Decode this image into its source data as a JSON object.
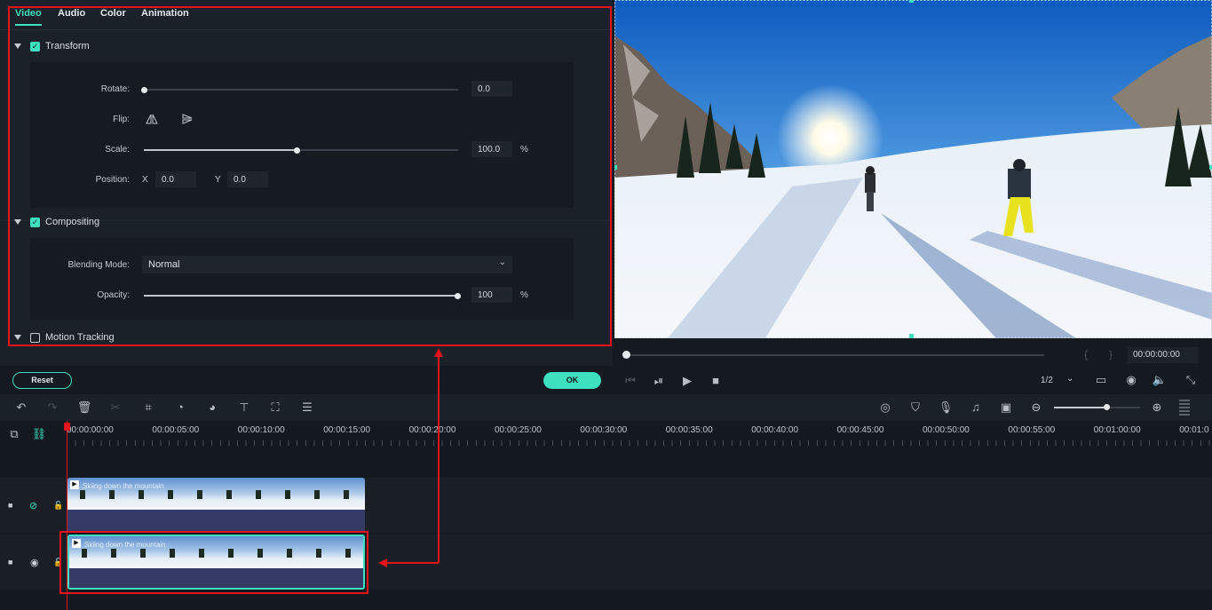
{
  "tabs": [
    "Video",
    "Audio",
    "Color",
    "Animation"
  ],
  "transform": {
    "title": "Transform",
    "rotate_label": "Rotate:",
    "rotate_value": "0.0",
    "flip_label": "Flip:",
    "scale_label": "Scale:",
    "scale_value": "100.0",
    "scale_unit": "%",
    "scale_level": 0.49,
    "position_label": "Position:",
    "pos_x_label": "X",
    "pos_x_value": "0.0",
    "pos_y_label": "Y",
    "pos_y_value": "0.0"
  },
  "compositing": {
    "title": "Compositing",
    "blend_label": "Blending Mode:",
    "blend_value": "Normal",
    "opacity_label": "Opacity:",
    "opacity_value": "100",
    "opacity_unit": "%",
    "opacity_level": 1.0
  },
  "motion_tracking": {
    "title": "Motion Tracking"
  },
  "reset_label": "Reset",
  "ok_label": "OK",
  "player": {
    "timecode": "00:00:00:00",
    "quality": "1/2"
  },
  "ruler": [
    "00:00:00:00",
    "00:00:05:00",
    "00:00:10:00",
    "00:00:15:00",
    "00:00:20:00",
    "00:00:25:00",
    "00:00:30:00",
    "00:00:35:00",
    "00:00:40:00",
    "00:00:45:00",
    "00:00:50:00",
    "00:00:55:00",
    "00:01:00:00",
    "00:01:0"
  ],
  "clips": [
    {
      "title": "Skiing down the mountain"
    },
    {
      "title": "Skiing down the mountain"
    }
  ],
  "colors": {
    "accent": "#3fe0c0",
    "highlight": "#e3131b"
  }
}
